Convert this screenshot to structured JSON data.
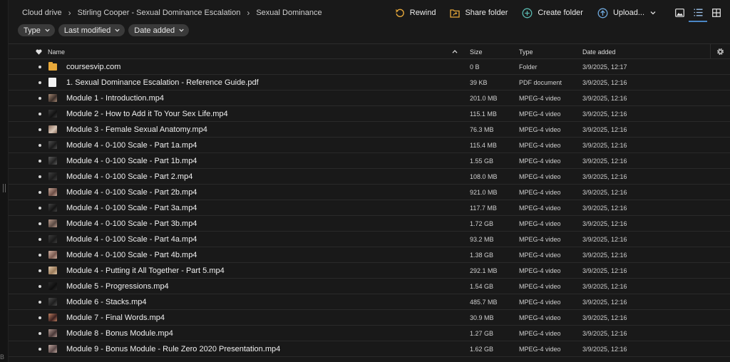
{
  "breadcrumb": [
    "Cloud drive",
    "Stirling Cooper - Sexual Dominance Escalation",
    "Sexual Dominance"
  ],
  "actions": {
    "rewind": "Rewind",
    "share_folder": "Share folder",
    "create_folder": "Create folder",
    "upload": "Upload..."
  },
  "filters": [
    "Type",
    "Last modified",
    "Date added"
  ],
  "columns": {
    "name": "Name",
    "size": "Size",
    "type": "Type",
    "date_added": "Date added"
  },
  "files": [
    {
      "name": "coursesvip.com",
      "size": "0 B",
      "type": "Folder",
      "date": "3/9/2025, 12:17",
      "thumb": "folder"
    },
    {
      "name": "1. Sexual Dominance Escalation - Reference Guide.pdf",
      "size": "39 KB",
      "type": "PDF document",
      "date": "3/9/2025, 12:16",
      "thumb": "pdf"
    },
    {
      "name": "Module 1 - Introduction.mp4",
      "size": "201.0 MB",
      "type": "MPEG-4 video",
      "date": "3/9/2025, 12:16",
      "thumb": "video"
    },
    {
      "name": "Module 2 - How to Add it To Your Sex Life.mp4",
      "size": "115.1 MB",
      "type": "MPEG-4 video",
      "date": "3/9/2025, 12:16",
      "thumb": "video"
    },
    {
      "name": "Module 3 - Female Sexual Anatomy.mp4",
      "size": "76.3 MB",
      "type": "MPEG-4 video",
      "date": "3/9/2025, 12:16",
      "thumb": "video"
    },
    {
      "name": "Module 4 - 0-100 Scale - Part 1a.mp4",
      "size": "115.4 MB",
      "type": "MPEG-4 video",
      "date": "3/9/2025, 12:16",
      "thumb": "video"
    },
    {
      "name": "Module 4 - 0-100 Scale - Part 1b.mp4",
      "size": "1.55 GB",
      "type": "MPEG-4 video",
      "date": "3/9/2025, 12:16",
      "thumb": "video"
    },
    {
      "name": "Module 4 - 0-100 Scale - Part 2.mp4",
      "size": "108.0 MB",
      "type": "MPEG-4 video",
      "date": "3/9/2025, 12:16",
      "thumb": "video"
    },
    {
      "name": "Module 4 - 0-100 Scale - Part 2b.mp4",
      "size": "921.0 MB",
      "type": "MPEG-4 video",
      "date": "3/9/2025, 12:16",
      "thumb": "video"
    },
    {
      "name": "Module 4 - 0-100 Scale - Part 3a.mp4",
      "size": "117.7 MB",
      "type": "MPEG-4 video",
      "date": "3/9/2025, 12:16",
      "thumb": "video"
    },
    {
      "name": "Module 4 - 0-100 Scale - Part 3b.mp4",
      "size": "1.72 GB",
      "type": "MPEG-4 video",
      "date": "3/9/2025, 12:16",
      "thumb": "video"
    },
    {
      "name": "Module 4 - 0-100 Scale - Part 4a.mp4",
      "size": "93.2 MB",
      "type": "MPEG-4 video",
      "date": "3/9/2025, 12:16",
      "thumb": "video"
    },
    {
      "name": "Module 4 - 0-100 Scale - Part 4b.mp4",
      "size": "1.38 GB",
      "type": "MPEG-4 video",
      "date": "3/9/2025, 12:16",
      "thumb": "video"
    },
    {
      "name": "Module 4 - Putting it All Together - Part 5.mp4",
      "size": "292.1 MB",
      "type": "MPEG-4 video",
      "date": "3/9/2025, 12:16",
      "thumb": "video"
    },
    {
      "name": "Module 5 - Progressions.mp4",
      "size": "1.54 GB",
      "type": "MPEG-4 video",
      "date": "3/9/2025, 12:16",
      "thumb": "video"
    },
    {
      "name": "Module 6 - Stacks.mp4",
      "size": "485.7 MB",
      "type": "MPEG-4 video",
      "date": "3/9/2025, 12:16",
      "thumb": "video"
    },
    {
      "name": "Module 7 - Final Words.mp4",
      "size": "30.9 MB",
      "type": "MPEG-4 video",
      "date": "3/9/2025, 12:16",
      "thumb": "video"
    },
    {
      "name": "Module 8 - Bonus Module.mp4",
      "size": "1.27 GB",
      "type": "MPEG-4 video",
      "date": "3/9/2025, 12:16",
      "thumb": "video"
    },
    {
      "name": "Module 9 - Bonus Module - Rule Zero 2020 Presentation.mp4",
      "size": "1.62 GB",
      "type": "MPEG-4 video",
      "date": "3/9/2025, 12:16",
      "thumb": "video"
    }
  ],
  "colors": {
    "background": "#191919",
    "chip": "#3a3a3a",
    "folder": "#e8a93a",
    "rewind_icon": "#e8a93a",
    "share_icon": "#e8a93a",
    "create_icon": "#5ab9b0",
    "upload_icon": "#6fa8dc",
    "active_view": "#4a86c5"
  },
  "icons": {
    "rewind": "rewind-icon",
    "share_folder": "share-folder-icon",
    "create_folder": "create-folder-icon",
    "upload": "upload-icon",
    "views": [
      "image-view-icon",
      "list-view-icon",
      "grid-view-icon"
    ],
    "favourite_header": "heart-icon",
    "sort": "sort-ascending-icon",
    "settings": "gear-icon"
  }
}
